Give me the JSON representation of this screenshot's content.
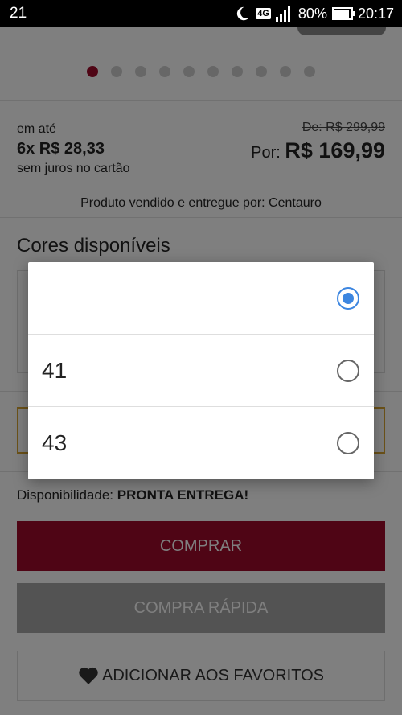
{
  "status_bar": {
    "notification": "21",
    "network": "4G",
    "battery": "80%",
    "time": "20:17"
  },
  "carousel": {
    "dot_count": 10,
    "active_index": 0
  },
  "pricing": {
    "installment_prefix": "em até",
    "installment_value": "6x R$ 28,33",
    "installment_suffix": "sem juros no cartão",
    "old_price": "De: R$ 299,99",
    "price_label": "Por:",
    "price_value": "R$ 169,99"
  },
  "seller": "Produto vendido e entregue por: Centauro",
  "colors_title": "Cores disponíveis",
  "availability": {
    "label": "Disponibilidade:",
    "value": "PRONTA ENTREGA!"
  },
  "buttons": {
    "buy": "COMPRAR",
    "quick_buy": "COMPRA RÁPIDA",
    "favorites": "ADICIONAR AOS FAVORITOS"
  },
  "size_dialog": {
    "options": [
      {
        "label": "",
        "selected": true
      },
      {
        "label": "41",
        "selected": false
      },
      {
        "label": "43",
        "selected": false
      }
    ]
  },
  "colors": {
    "brand": "#9e0b2b",
    "radio_selected": "#3d86e0",
    "size_box_border": "#d9a531"
  }
}
